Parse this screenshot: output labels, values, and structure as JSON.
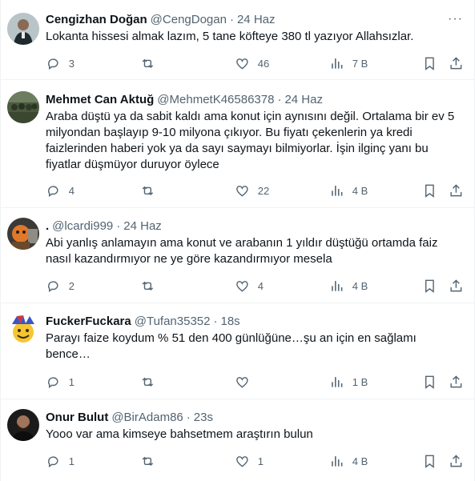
{
  "tweets": [
    {
      "name": "Cengizhan Doğan",
      "handle": "@CengDogan",
      "time": "24 Haz",
      "text": "Lokanta hissesi almak lazım, 5 tane köfteye 380 tl yazıyor Allahsızlar.",
      "replies": "3",
      "retweets": "",
      "likes": "46",
      "views": "7 B",
      "avatar_icon": "avatar-man-dark-shirt"
    },
    {
      "name": "Mehmet Can Aktuğ",
      "handle": "@MehmetK46586378",
      "time": "24 Haz",
      "text": "Araba düştü ya da sabit kaldı ama konut için aynısını değil. Ortalama bir ev 5 milyondan başlayıp 9-10 milyona çıkıyor. Bu fiyatı çekenlerin ya kredi faizlerinden haberi yok ya da sayı saymayı bilmiyorlar. İşin ilginç yanı bu fiyatlar düşmüyor duruyor öylece",
      "replies": "4",
      "retweets": "",
      "likes": "22",
      "views": "4 B",
      "avatar_icon": "avatar-group-photo"
    },
    {
      "name": ".",
      "handle": "@lcardi999",
      "time": "24 Haz",
      "text": "Abi yanlış anlamayın ama konut ve arabanın 1 yıldır düştüğü ortamda faiz nasıl kazandırmıyor ne ye göre kazandırmıyor mesela",
      "replies": "2",
      "retweets": "",
      "likes": "4",
      "views": "4 B",
      "avatar_icon": "avatar-orange-character"
    },
    {
      "name": "FuckerFuckara",
      "handle": "@Tufan35352",
      "time": "18s",
      "text": "Parayı faize koydum % 51 den 400 günlüğüne…şu an için en sağlamı bence…",
      "replies": "1",
      "retweets": "",
      "likes": "",
      "views": "1 B",
      "avatar_icon": "avatar-jester-emoji"
    },
    {
      "name": "Onur Bulut",
      "handle": "@BirAdam86",
      "time": "23s",
      "text": "Yooo var ama kimseye bahsetmem araştırın bulun",
      "replies": "1",
      "retweets": "",
      "likes": "1",
      "views": "4 B",
      "avatar_icon": "avatar-man-bearded"
    }
  ],
  "colors": {
    "text": "#0f1419",
    "secondary": "#536471",
    "border": "#eff3f4"
  }
}
